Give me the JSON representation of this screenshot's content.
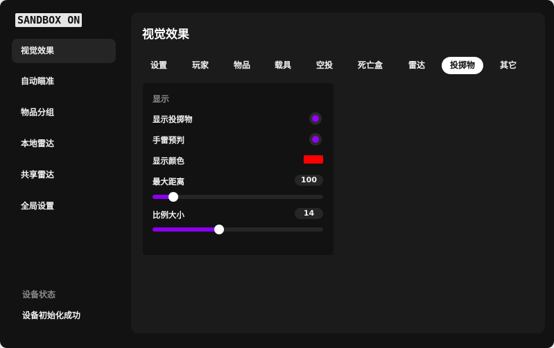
{
  "app": {
    "logo_text": "SANDBOX ON"
  },
  "sidebar": {
    "items": [
      {
        "label": "视觉效果"
      },
      {
        "label": "自动瞄准"
      },
      {
        "label": "物品分组"
      },
      {
        "label": "本地雷达"
      },
      {
        "label": "共享雷达"
      },
      {
        "label": "全局设置"
      }
    ],
    "active_index": 0,
    "status_title": "设备状态",
    "status_text": "设备初始化成功"
  },
  "main": {
    "title": "视觉效果",
    "tabs": [
      {
        "label": "设置"
      },
      {
        "label": "玩家"
      },
      {
        "label": "物品"
      },
      {
        "label": "载具"
      },
      {
        "label": "空投"
      },
      {
        "label": "死亡盒"
      },
      {
        "label": "雷达"
      },
      {
        "label": "投掷物"
      },
      {
        "label": "其它"
      }
    ],
    "active_tab": 7
  },
  "panel": {
    "section_title": "显示",
    "show_throwables": {
      "label": "显示投掷物",
      "checked": true
    },
    "grenade_predict": {
      "label": "手雷预判",
      "checked": true
    },
    "display_color": {
      "label": "显示颜色",
      "color": "#ff0000"
    },
    "max_distance": {
      "label": "最大距离",
      "value": "100",
      "fraction": 0.12
    },
    "scale_size": {
      "label": "比例大小",
      "value": "14",
      "fraction": 0.39
    }
  },
  "colors": {
    "accent": "#9400ff",
    "background": "#121212",
    "panel": "#1b1b1b"
  }
}
